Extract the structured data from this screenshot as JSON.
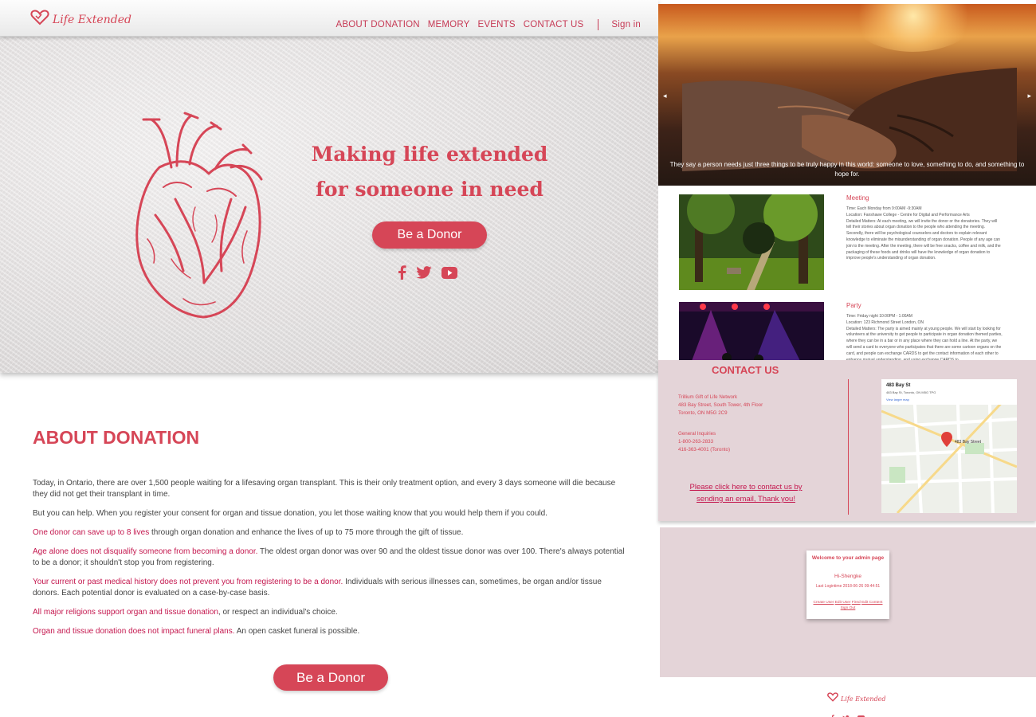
{
  "brand": {
    "name": "Life Extended",
    "accent": "#d64657",
    "accent_dark": "#c4174e",
    "panel_pink": "#e4d4d8"
  },
  "nav": {
    "items": [
      "ABOUT DONATION",
      "MEMORY",
      "EVENTS",
      "CONTACT US"
    ],
    "signin": "Sign in"
  },
  "hero": {
    "headline_line1": "Making life extended",
    "headline_line2": "for someone in need",
    "cta": "Be a Donor",
    "social_icons": [
      "facebook-icon",
      "twitter-icon",
      "youtube-icon"
    ]
  },
  "about": {
    "title": "ABOUT DONATION",
    "paragraphs": [
      {
        "highlight": "",
        "text": "Today, in Ontario, there are over 1,500 people waiting for a lifesaving organ transplant. This is their only treatment option, and every 3 days someone will die because they did not get their transplant in time."
      },
      {
        "highlight": "",
        "text": "But you can help. When you register your consent for organ and tissue donation, you let those waiting know that you would help them if you could."
      },
      {
        "highlight": "One donor can save up to 8 lives",
        "text": " through organ donation and enhance the lives of up to 75 more through the gift of tissue."
      },
      {
        "highlight": "Age alone does not disqualify someone from becoming a donor.",
        "text": " The oldest organ donor was over 90 and the oldest tissue donor was over 100. There's always potential to be a donor; it shouldn't stop you from registering."
      },
      {
        "highlight": "Your current or past medical history does not prevent you from registering to be a donor.",
        "text": " Individuals with serious illnesses can, sometimes, be organ and/or tissue donors. Each potential donor is evaluated on a case-by-case basis."
      },
      {
        "highlight": "All major religions support organ and tissue donation",
        "text": ", or respect an individual's choice."
      },
      {
        "highlight": "Organ and tissue donation does not impact funeral plans.",
        "text": " An open casket funeral is possible."
      }
    ],
    "cta": "Be a Donor"
  },
  "slideshow": {
    "prev": "◂",
    "next": "▸",
    "caption": "They say a person needs just three things to be truly happy in this world: someone to love, something to do, and something to hope for."
  },
  "events": [
    {
      "title": "Meeting",
      "lines": [
        "Time: Each Monday from 9:00AM -9:30AM",
        "Location: Fanshawe College - Centre for Digital and Performance Arts",
        "Detailed Matters: At each meeting, we will invite the donor or the donatories. They will tell their stories about organ donation to the people who attending the meeting. Secondly, there will be psychological counselors and doctors to explain relevant knowledge to eliminate the misunderstanding of organ donation. People of any age can join to the meeting. After the meeting, there will be free snacks, coffee and milk, and the packaging of these foods and drinks will have the knowledge of organ donation to improve people's understanding of organ donation."
      ]
    },
    {
      "title": "Party",
      "lines": [
        "Time: Friday night 10:00PM - 1:00AM",
        "Location: 123 Richmond Street London, ON",
        "Detailed Matters: The party is aimed mainly at young people. We will start by looking for volunteers at the university to get people to participate in organ donation themed parties, where they can be in a bar or in any place where they can hold a line. At the party, we will send a card to everyone who participates that there are some cartoon organs on the card, and people can exchange CARDS to get the contact information of each other to enhance mutual understanding, and using exchange CARDS to"
      ]
    }
  ],
  "contact": {
    "title": "CONTACT US",
    "org": "Trillium Gift of Life Network",
    "street": "483 Bay Street, South Tower, 4th Floor",
    "city": "Toronto, ON M5G 2C9",
    "inquiries_label": "General Inquiries",
    "phone1": "1-800-263-2833",
    "phone2": "416-363-4001 (Toronto)",
    "link_line1": "Please click here to contact us by",
    "link_line2": "sending an email, Thank you!",
    "map": {
      "title": "483 Bay St",
      "subtitle": "483 Bay St, Toronto, ON M5G TPG",
      "larger_map": "View larger map",
      "pin_label": "483 Bay Street"
    }
  },
  "admin": {
    "title": "Welcome to your admin page",
    "greeting": "Hi-Shengke",
    "last_login": "Last Logintime 2018-06-26 09:44:51",
    "links": [
      "Create User",
      "Edit User",
      "Fired",
      "Edit Content",
      "Sign Out"
    ]
  },
  "footer": {
    "brand": "Life Extended",
    "social_icons": [
      "facebook-icon",
      "twitter-icon",
      "youtube-icon"
    ]
  }
}
